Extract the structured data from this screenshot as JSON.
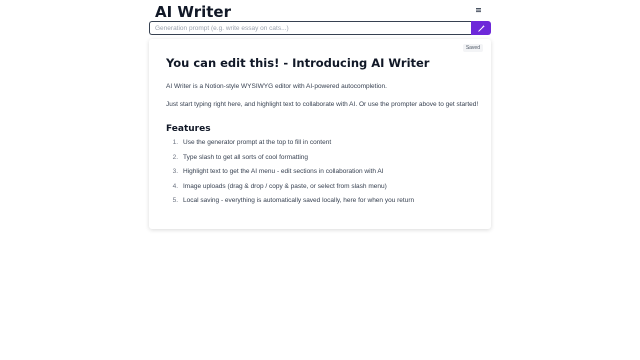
{
  "header": {
    "title": "AI Writer",
    "menu_icon": "hamburger-icon"
  },
  "prompt": {
    "placeholder": "Generation prompt (e.g. write essay on cats...)",
    "value": "",
    "submit_icon": "magic-wand-icon",
    "accent_color": "#6d28d9"
  },
  "editor": {
    "status": "Saved",
    "title": "You can edit this! - Introducing AI Writer",
    "paragraphs": [
      "AI Writer is a Notion-style WYSIWYG editor with AI-powered autocompletion.",
      "Just start typing right here, and highlight text to collaborate with AI. Or use the prompter above to get started!"
    ],
    "features_heading": "Features",
    "features": [
      {
        "num": "1.",
        "text": "Use the generator prompt at the top to fill in content"
      },
      {
        "num": "2.",
        "text": "Type slash to get all sorts of cool formatting"
      },
      {
        "num": "3.",
        "text": "Highlight text to get the AI menu - edit sections in collaboration with AI"
      },
      {
        "num": "4.",
        "text": "Image uploads (drag & drop / copy & paste, or select from slash menu)"
      },
      {
        "num": "5.",
        "text": "Local saving - everything is automatically saved locally, here for when you return"
      }
    ]
  }
}
